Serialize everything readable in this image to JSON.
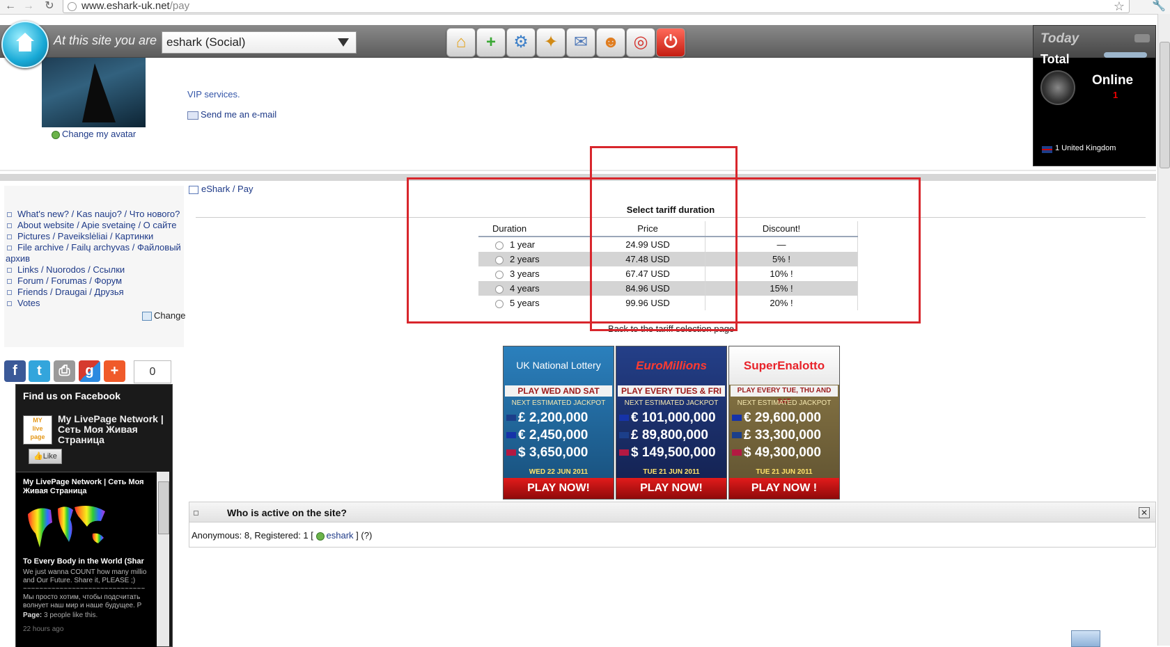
{
  "browser": {
    "url": "www.eshark-uk.net/pay",
    "url_host": "www.eshark-uk.net",
    "url_path": "/pay"
  },
  "toolbar": {
    "site_label": "At this site you are",
    "site_select_value": "eshark (Social)",
    "icons": [
      "home-icon",
      "add-icon",
      "settings-gear-icon",
      "magic-wand-icon",
      "mail-icon",
      "users-icon",
      "lifebuoy-help-icon",
      "power-icon"
    ]
  },
  "stats_panel": {
    "today_label": "Today",
    "total_label": "Total",
    "online_label": "Online",
    "online_count": "1",
    "country_text": "1 United Kingdom"
  },
  "profile": {
    "change_avatar": "Change my avatar",
    "vip_link": "VIP services.",
    "email_link": "Send me an e-mail"
  },
  "side_menu": {
    "items": [
      "What's new? / Kas naujo? / Что нового?",
      "About website / Apie svetainę / О сайте",
      "Pictures / Paveikslėliai / Картинки",
      "File archive / Failų archyvas / Файловый",
      "архив",
      "Links / Nuorodos / Ссылки",
      "Forum / Forumas / Форум",
      "Friends / Draugai / Друзья",
      "Votes"
    ],
    "change_label": "Change"
  },
  "share": {
    "count": "0"
  },
  "facebook": {
    "header": "Find us on Facebook",
    "logo_text": "MY livepage",
    "page_name": "My LivePage Network | Сеть Моя Живая Страница",
    "like_label": "Like",
    "feed_title": "My LivePage Network | Сеть Моя Живая Страница",
    "post_title": "To Every Body in the World (Shar",
    "post_text": "We just wanna COUNT how many millio\nand Our Future. Share it, PLEASE ;)\n~~~~~~~~~~~~~~~~~~~~~~~~~~~~~~\nМы просто хотим, чтобы подсчитать\nволнует наш мир и наше будущее. P",
    "post_meta_label": "Page:",
    "post_meta_text": " 3 people like this.",
    "post_time": "22 hours ago"
  },
  "breadcrumb": {
    "home": "eShark",
    "separator": " / ",
    "current": "Pay"
  },
  "tariff": {
    "title": "Select tariff duration",
    "headers": [
      "Duration",
      "Price",
      "Discount!"
    ],
    "rows": [
      {
        "duration": "1 year",
        "price": "24.99 USD",
        "discount": "—"
      },
      {
        "duration": "2 years",
        "price": "47.48 USD",
        "discount": "5% !"
      },
      {
        "duration": "3 years",
        "price": "67.47 USD",
        "discount": "10% !"
      },
      {
        "duration": "4 years",
        "price": "84.96 USD",
        "discount": "15% !"
      },
      {
        "duration": "5 years",
        "price": "99.96 USD",
        "discount": "20% !"
      }
    ],
    "back_link": "Back to the tariff selection page"
  },
  "lotteries": [
    {
      "name": "UK National Lottery",
      "tag": "PLAY WED AND SAT",
      "next": "NEXT ESTIMATED JACKPOT",
      "amounts": [
        "£ 2,200,000",
        "€ 2,450,000",
        "$ 3,650,000"
      ],
      "date": "WED 22 JUN 2011",
      "play": "PLAY NOW!",
      "color": "#1d5d8c"
    },
    {
      "name": "EuroMillions",
      "tag": "PLAY EVERY TUES & FRI",
      "next": "NEXT ESTIMATED JACKPOT",
      "amounts": [
        "€ 101,000,000",
        "£ 89,800,000",
        "$ 149,500,000"
      ],
      "date": "TUE 21 JUN 2011",
      "play": "PLAY NOW!",
      "color": "#1a2f6a"
    },
    {
      "name": "SuperEnalotto",
      "tag": "PLAY EVERY TUE, THU AND SAT",
      "next": "NEXT ESTIMATED JACKPOT",
      "amounts": [
        "€ 29,600,000",
        "£ 33,300,000",
        "$ 49,300,000"
      ],
      "date": "TUE 21 JUN 2011",
      "play": "PLAY NOW !",
      "color": "#7a6a3e"
    }
  ],
  "active": {
    "title": "Who is active on the site?",
    "prefix": "Anonymous: 8, Registered: 1 [",
    "user": "eshark",
    "suffix": "] (?)"
  }
}
